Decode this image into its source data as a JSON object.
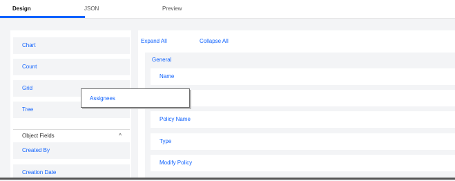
{
  "tabs": [
    {
      "label": "Design",
      "active": true
    },
    {
      "label": "JSON",
      "active": false
    },
    {
      "label": "Preview",
      "active": false
    }
  ],
  "left": {
    "items": [
      "Chart",
      "Count",
      "Grid",
      "Tree"
    ],
    "object_fields_header": "Object Fields",
    "fields": [
      "Created By",
      "Creation Date"
    ]
  },
  "right": {
    "expand_all": "Expand All",
    "collapse_all": "Collapse All",
    "general_label": "General",
    "rows": [
      "Name",
      "Policy Name",
      "Type",
      "Modify Policy"
    ]
  },
  "drag_popup": {
    "label": "Assignees"
  },
  "colors": {
    "accent": "#0f62fe",
    "panel": "#f3f4f6"
  }
}
